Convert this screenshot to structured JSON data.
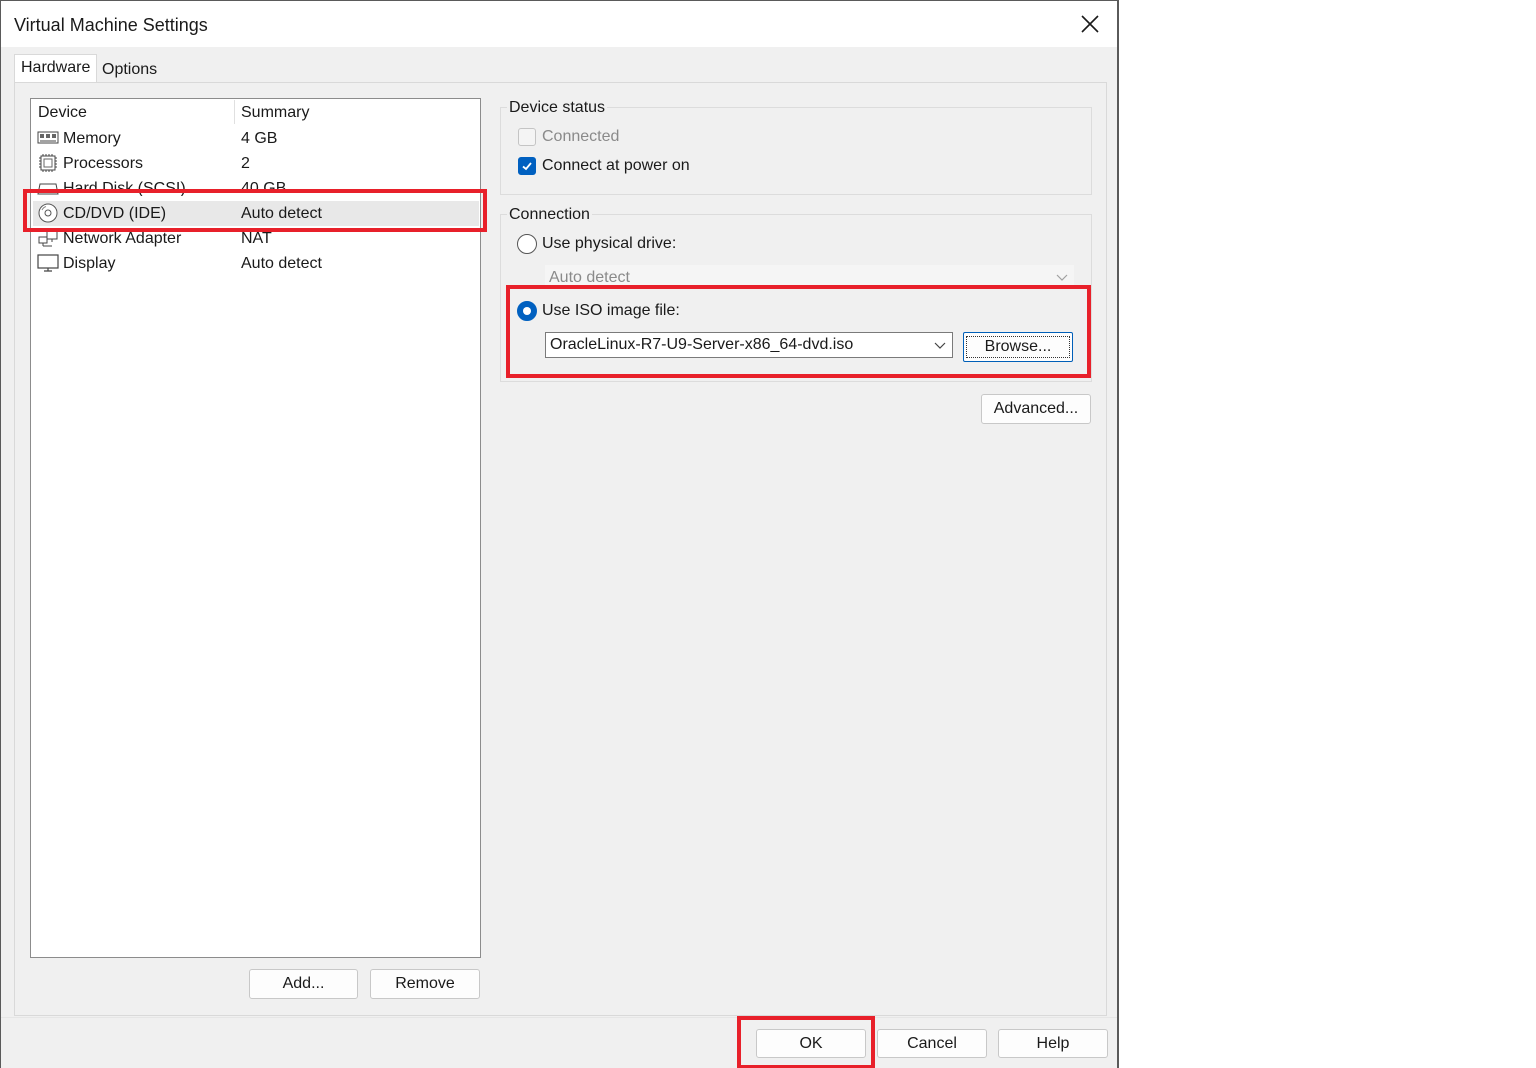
{
  "window": {
    "title": "Virtual Machine Settings"
  },
  "tabs": [
    {
      "label": "Hardware"
    },
    {
      "label": "Options"
    }
  ],
  "device_list": {
    "headers": {
      "device": "Device",
      "summary": "Summary"
    },
    "rows": [
      {
        "icon": "memory-icon",
        "name": "Memory",
        "summary": "4 GB"
      },
      {
        "icon": "processor-icon",
        "name": "Processors",
        "summary": "2"
      },
      {
        "icon": "hard-disk-icon",
        "name": "Hard Disk (SCSI)",
        "summary": "40 GB"
      },
      {
        "icon": "cd-dvd-icon",
        "name": "CD/DVD (IDE)",
        "summary": "Auto detect"
      },
      {
        "icon": "network-adapter-icon",
        "name": "Network Adapter",
        "summary": "NAT"
      },
      {
        "icon": "display-icon",
        "name": "Display",
        "summary": "Auto detect"
      }
    ],
    "selected_index": 3
  },
  "list_buttons": {
    "add": "Add...",
    "remove": "Remove"
  },
  "device_status": {
    "label": "Device status",
    "connected": {
      "label": "Connected",
      "checked": false,
      "enabled": false
    },
    "connect_at_power_on": {
      "label": "Connect at power on",
      "checked": true
    }
  },
  "connection": {
    "label": "Connection",
    "physical_drive": {
      "label": "Use physical drive:",
      "selected": false,
      "value": "Auto detect"
    },
    "iso_image": {
      "label": "Use ISO image file:",
      "selected": true,
      "value": "OracleLinux-R7-U9-Server-x86_64-dvd.iso"
    },
    "browse": "Browse...",
    "advanced": "Advanced..."
  },
  "footer": {
    "ok": "OK",
    "cancel": "Cancel",
    "help": "Help"
  },
  "colors": {
    "accent": "#0060c0",
    "highlight": "#e8202a"
  }
}
